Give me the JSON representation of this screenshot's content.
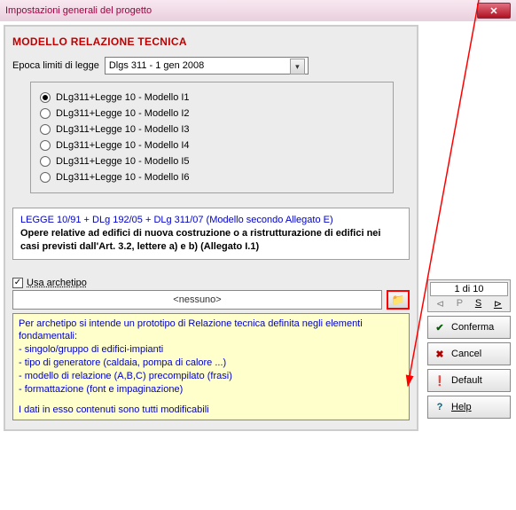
{
  "window": {
    "title": "Impostazioni generali del progetto"
  },
  "section": {
    "title": "MODELLO RELAZIONE TECNICA"
  },
  "epoch": {
    "label": "Epoca limiti di legge",
    "selected": "Dlgs 311 - 1 gen 2008"
  },
  "radios": {
    "selected_index": 0,
    "items": [
      {
        "label": "DLg311+Legge 10 - Modello I1"
      },
      {
        "label": "DLg311+Legge 10 - Modello I2"
      },
      {
        "label": "DLg311+Legge 10 - Modello I3"
      },
      {
        "label": "DLg311+Legge 10 - Modello I4"
      },
      {
        "label": "DLg311+Legge 10 - Modello I5"
      },
      {
        "label": "DLg311+Legge 10 - Modello I6"
      }
    ]
  },
  "info": {
    "line1": "LEGGE 10/91 + DLg 192/05 + DLg 311/07 (Modello secondo Allegato E)",
    "line2": "Opere relative ad edifici di nuova costruzione o a ristrutturazione di edifici nei casi previsti dall'Art. 3.2, lettere a) e b) (Allegato I.1)"
  },
  "archetype": {
    "checkbox_label": "Usa archetipo",
    "checked": true,
    "value": "<nessuno>",
    "description": {
      "intro": "Per archetipo si intende un prototipo di Relazione tecnica definita negli elementi fondamentali:",
      "b1": "- singolo/gruppo di edifici-impianti",
      "b2": "- tipo di generatore (caldaia, pompa di calore ...)",
      "b3": "- modello di relazione (A,B,C) precompilato (frasi)",
      "b4": "- formattazione (font e impaginazione)",
      "footer": "I dati in esso contenuti sono tutti modificabili"
    }
  },
  "pager": {
    "text": "1 di 10",
    "prev2": "⊲",
    "prev": "P",
    "next": "S",
    "next2": "⊳"
  },
  "buttons": {
    "confirm": "Conferma",
    "cancel": "Cancel",
    "default": "Default",
    "help": "Help"
  }
}
